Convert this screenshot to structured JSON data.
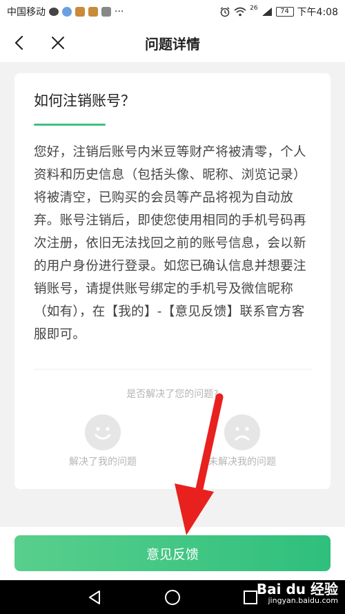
{
  "status_bar": {
    "carrier": "中国移动",
    "signal": "26",
    "battery": "74",
    "time": "下午4:08",
    "more": "···"
  },
  "nav": {
    "title": "问题详情"
  },
  "question": {
    "title": "如何注销账号？",
    "answer": "您好，注销后账号内米豆等财产将被清零，个人资料和历史信息（包括头像、昵称、浏览记录）将被清空，已购买的会员等产品将视为自动放弃。账号注销后，即使您使用相同的手机号码再次注册，依旧无法找回之前的账号信息，会以新的用户身份进行登录。如您已确认信息并想要注销账号，请提供账号绑定的手机号及微信昵称（如有），在【我的】-【意见反馈】联系官方客服即可。"
  },
  "resolution": {
    "prompt": "是否解决了您的问题?",
    "yes_label": "解决了我的问题",
    "no_label": "未解决我的问题"
  },
  "footer": {
    "feedback_button": "意见反馈"
  },
  "watermark": {
    "brand": "Bai du 经验",
    "url": "jingyan.baidu.com"
  },
  "colors": {
    "accent": "#3ec07f",
    "button_gradient_start": "#59cf8c",
    "button_gradient_end": "#2fbf7d",
    "annotation_arrow": "#e8211f"
  }
}
